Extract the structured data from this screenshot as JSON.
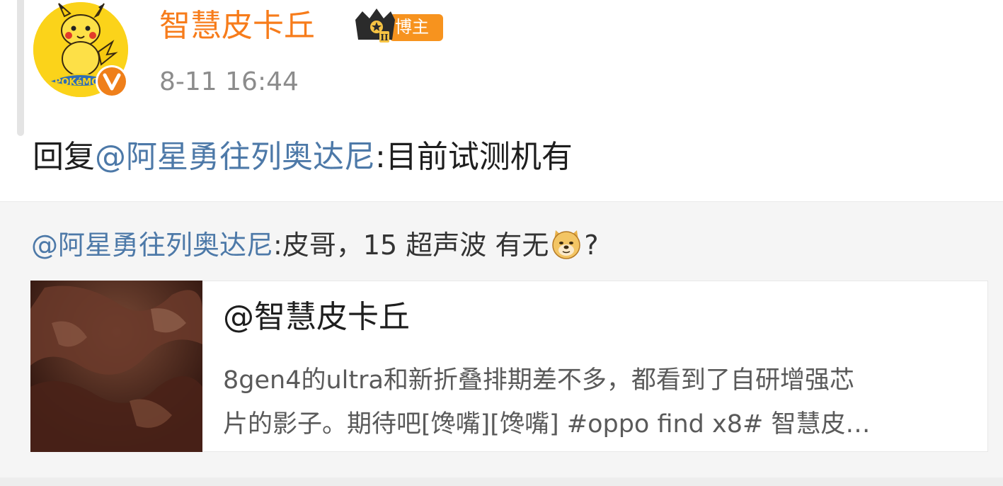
{
  "post": {
    "author": {
      "name": "智慧皮卡丘",
      "badge_label": "博主",
      "badge_level": "II",
      "avatar_text": "POKéMON"
    },
    "timestamp": "8-11 16:44",
    "reply": {
      "prefix": "回复",
      "mention": "@阿星勇往列奥达尼",
      "separator": ":",
      "text": "目前试测机有"
    }
  },
  "quoted": {
    "mention": "@阿星勇往列奥达尼",
    "separator": ":",
    "text": "皮哥，15 超声波 有无",
    "emoji": "doge-emoji",
    "suffix": "?",
    "card": {
      "title": "@智慧皮卡丘",
      "desc_line1": "8gen4的ultra和新折叠排期差不多，都看到了自研增强芯",
      "desc_line2": "片的影子。期待吧[馋嘴][馋嘴] #oppo find x8#  智慧皮…"
    }
  },
  "colors": {
    "username": "#f77c1b",
    "mention": "#4d79a8",
    "badge": "#f7931e",
    "verify": "#ef7f1a",
    "avatar_bg": "#fbd31a"
  }
}
